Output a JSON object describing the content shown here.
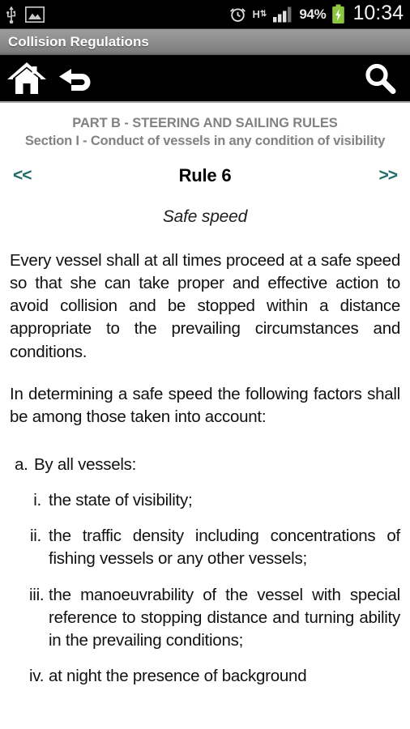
{
  "statusbar": {
    "left_icons": [
      "usb-icon",
      "gallery-image-icon"
    ],
    "right_icons": [
      "alarm-clock-icon",
      "hspa-network-icon",
      "signal-bars-icon",
      "battery-charging-icon"
    ],
    "network_type": "H",
    "network_arrows": "⇅",
    "battery_percent": "94%",
    "clock": "10:34",
    "battery_color": "#8dc63f",
    "background": "#000000"
  },
  "titlebar": {
    "title": "Collision Regulations"
  },
  "actionbar": {
    "home_label": "home-icon",
    "back_label": "back-icon",
    "search_label": "search-icon"
  },
  "header": {
    "part": "PART B - STEERING AND SAILING RULES",
    "section": "Section I - Conduct of vessels in any condition of visibility",
    "color": "#828282"
  },
  "rulenav": {
    "prev": "<<",
    "next": ">>",
    "title": "Rule 6",
    "link_color": "#1f6b68"
  },
  "rule": {
    "subtitle": "Safe speed",
    "paragraphs": [
      "Every vessel shall at all times proceed at a safe speed so that she can take proper and effective action to avoid collision and be stopped within a distance appropriate to the prevailing circumstances and conditions.",
      "In determining a safe speed the following factors shall be among those taken into account:"
    ],
    "items": [
      {
        "marker": "a.",
        "text": "By all vessels:",
        "subitems": [
          {
            "marker": "i.",
            "text": "the state of visibility;"
          },
          {
            "marker": "ii.",
            "text": "the traffic density including concentrations of fishing vessels or any other vessels;"
          },
          {
            "marker": "iii.",
            "text": "the manoeuvrability of the vessel with special reference to stopping distance and turning ability in the prevailing conditions;"
          },
          {
            "marker": "iv.",
            "text": "at night the presence of background"
          }
        ]
      }
    ]
  }
}
